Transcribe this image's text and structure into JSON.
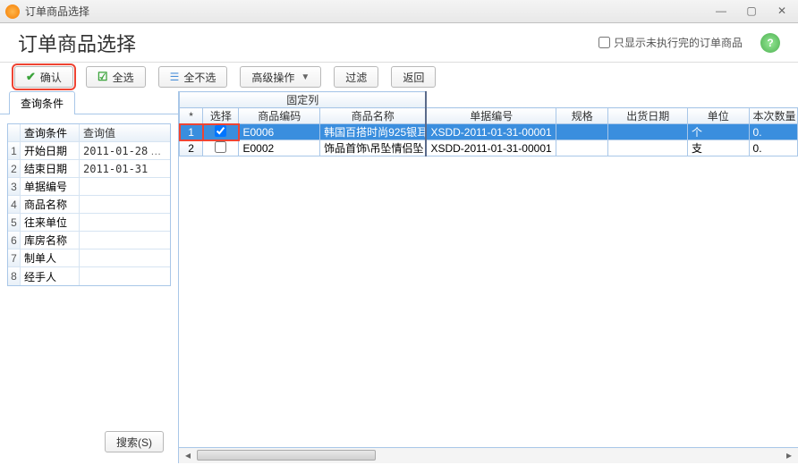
{
  "window": {
    "title": "订单商品选择",
    "header": "订单商品选择",
    "only_unfinished_label": "只显示未执行完的订单商品",
    "only_unfinished_checked": false
  },
  "toolbar": {
    "confirm": "确认",
    "select_all": "全选",
    "deselect_all": "全不选",
    "advanced": "高级操作",
    "filter": "过滤",
    "back": "返回"
  },
  "sidebar": {
    "tab": "查询条件",
    "head_key": "查询条件",
    "head_val": "查询值",
    "rows": [
      {
        "idx": "1",
        "key": "开始日期",
        "val": "2011-01-28",
        "has_picker": true
      },
      {
        "idx": "2",
        "key": "结束日期",
        "val": "2011-01-31",
        "has_picker": false
      },
      {
        "idx": "3",
        "key": "单据编号",
        "val": "",
        "has_picker": false
      },
      {
        "idx": "4",
        "key": "商品名称",
        "val": "",
        "has_picker": false
      },
      {
        "idx": "5",
        "key": "往来单位",
        "val": "",
        "has_picker": false
      },
      {
        "idx": "6",
        "key": "库房名称",
        "val": "",
        "has_picker": false
      },
      {
        "idx": "7",
        "key": "制单人",
        "val": "",
        "has_picker": false
      },
      {
        "idx": "8",
        "key": "经手人",
        "val": "",
        "has_picker": false
      }
    ],
    "search_btn": "搜索(S)"
  },
  "grid": {
    "fixed_header": "固定列",
    "columns": {
      "star": "*",
      "select": "选择",
      "code": "商品编码",
      "name": "商品名称",
      "doc": "单据编号",
      "spec": "规格",
      "ship": "出货日期",
      "unit": "单位",
      "qty": "本次数量"
    },
    "rows": [
      {
        "idx": "1",
        "selected": true,
        "checked": true,
        "code": "E0006",
        "name": "韩国百搭时尚925银耳",
        "doc": "XSDD-2011-01-31-00001",
        "spec": "",
        "ship": "",
        "unit": "个",
        "qty": "0."
      },
      {
        "idx": "2",
        "selected": false,
        "checked": false,
        "code": "E0002",
        "name": "饰品首饰\\吊坠情侣坠",
        "doc": "XSDD-2011-01-31-00001",
        "spec": "",
        "ship": "",
        "unit": "支",
        "qty": "0."
      }
    ]
  }
}
